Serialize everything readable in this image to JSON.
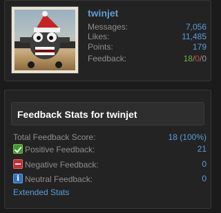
{
  "profile": {
    "username": "twinjet",
    "stats": [
      {
        "label": "Messages:",
        "value": "7,056"
      },
      {
        "label": "Likes:",
        "value": "11,485"
      },
      {
        "label": "Points:",
        "value": "179"
      }
    ],
    "feedback": {
      "label": "Feedback:",
      "positive": "18",
      "negative": "0",
      "neutral": "0",
      "separator": "/"
    }
  },
  "feedback_stats": {
    "title": "Feedback Stats for twinjet",
    "total": {
      "label": "Total Feedback Score:",
      "value": "18 (100%)"
    },
    "positive": {
      "label": "Positive Feedback:",
      "value": "21",
      "icon": "check-icon"
    },
    "negative": {
      "label": "Negative Feedback:",
      "value": "0",
      "icon": "minus-icon"
    },
    "neutral": {
      "label": "Neutral Feedback:",
      "value": "0",
      "icon": "info-icon"
    },
    "extended_link": "Extended Stats"
  },
  "colors": {
    "link": "#5b9ed8",
    "positive": "#6db33f",
    "negative": "#d14343",
    "background": "#1b1b1b"
  }
}
